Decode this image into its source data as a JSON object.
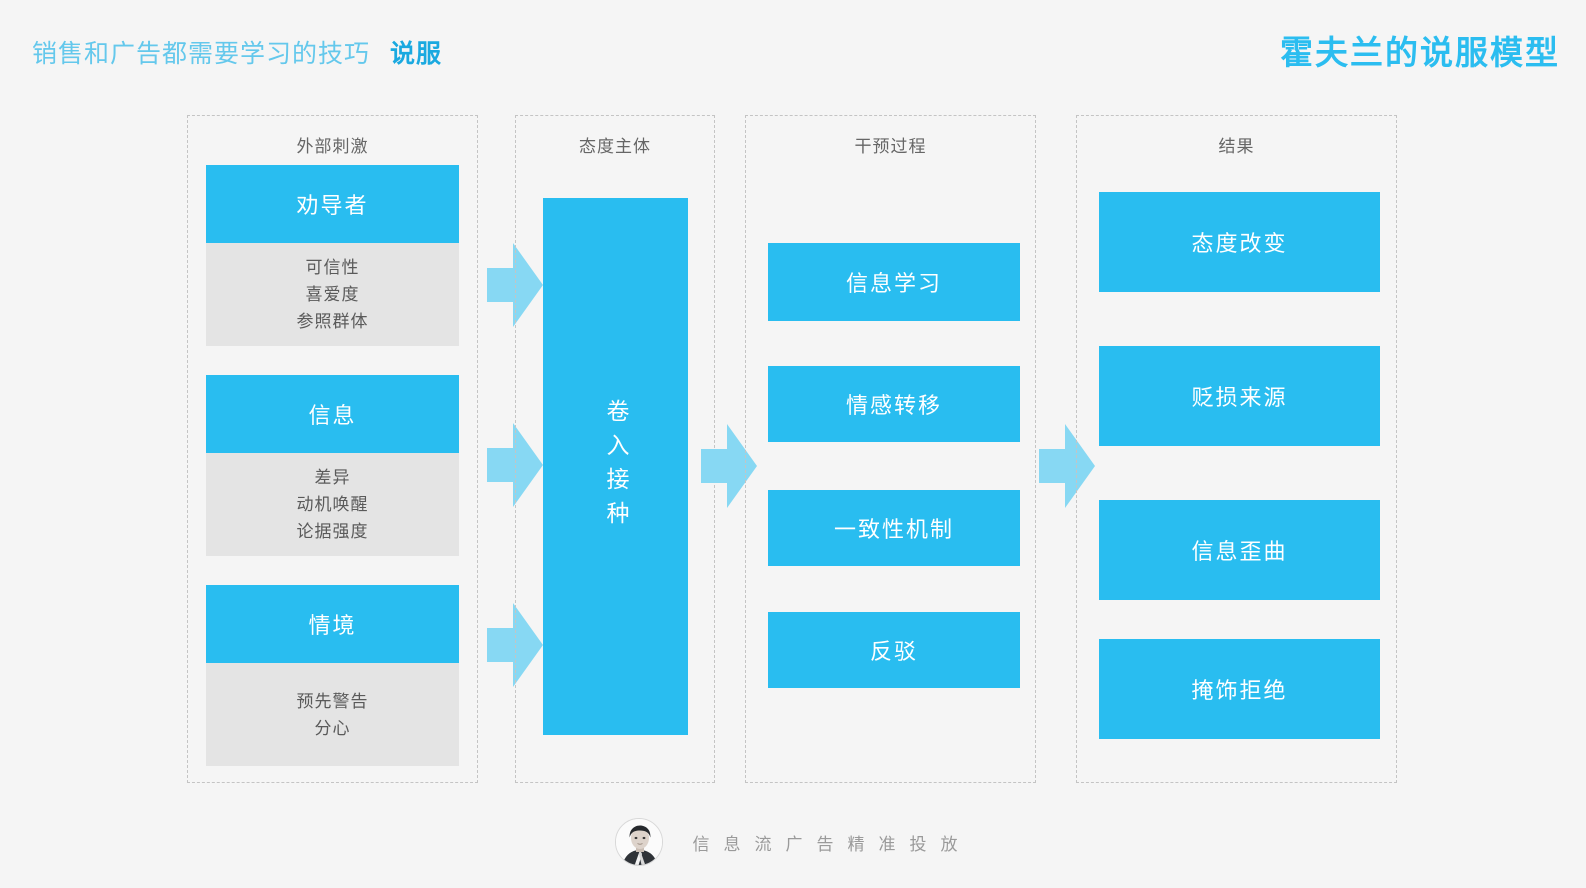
{
  "header": {
    "subtitle": "销售和广告都需要学习的技巧",
    "keyword": "说服",
    "title": "霍夫兰的说服模型"
  },
  "colors": {
    "primary": "#29bdf0",
    "primary_light": "#87d8f3",
    "gray_box": "#e4e4e4",
    "background": "#f5f5f5",
    "title_blue": "#2bbdf0",
    "subtitle_blue": "#64c8ec",
    "dashed_border": "#c4c4c4"
  },
  "columns": [
    {
      "id": "external-stimulus",
      "title": "外部刺激",
      "groups": [
        {
          "heading": "劝导者",
          "items": [
            "可信性",
            "喜爱度",
            "参照群体"
          ]
        },
        {
          "heading": "信息",
          "items": [
            "差异",
            "动机唤醒",
            "论据强度"
          ]
        },
        {
          "heading": "情境",
          "items": [
            "预先警告",
            "分心"
          ]
        }
      ]
    },
    {
      "id": "attitude-subject",
      "title": "态度主体",
      "vertical_label": "卷入接种"
    },
    {
      "id": "intervention-process",
      "title": "干预过程",
      "boxes": [
        "信息学习",
        "情感转移",
        "一致性机制",
        "反驳"
      ]
    },
    {
      "id": "result",
      "title": "结果",
      "boxes": [
        "态度改变",
        "贬损来源",
        "信息歪曲",
        "掩饰拒绝"
      ]
    }
  ],
  "footer": {
    "avatar_alt": "avatar-portrait",
    "text": "信息流广告精准投放"
  }
}
